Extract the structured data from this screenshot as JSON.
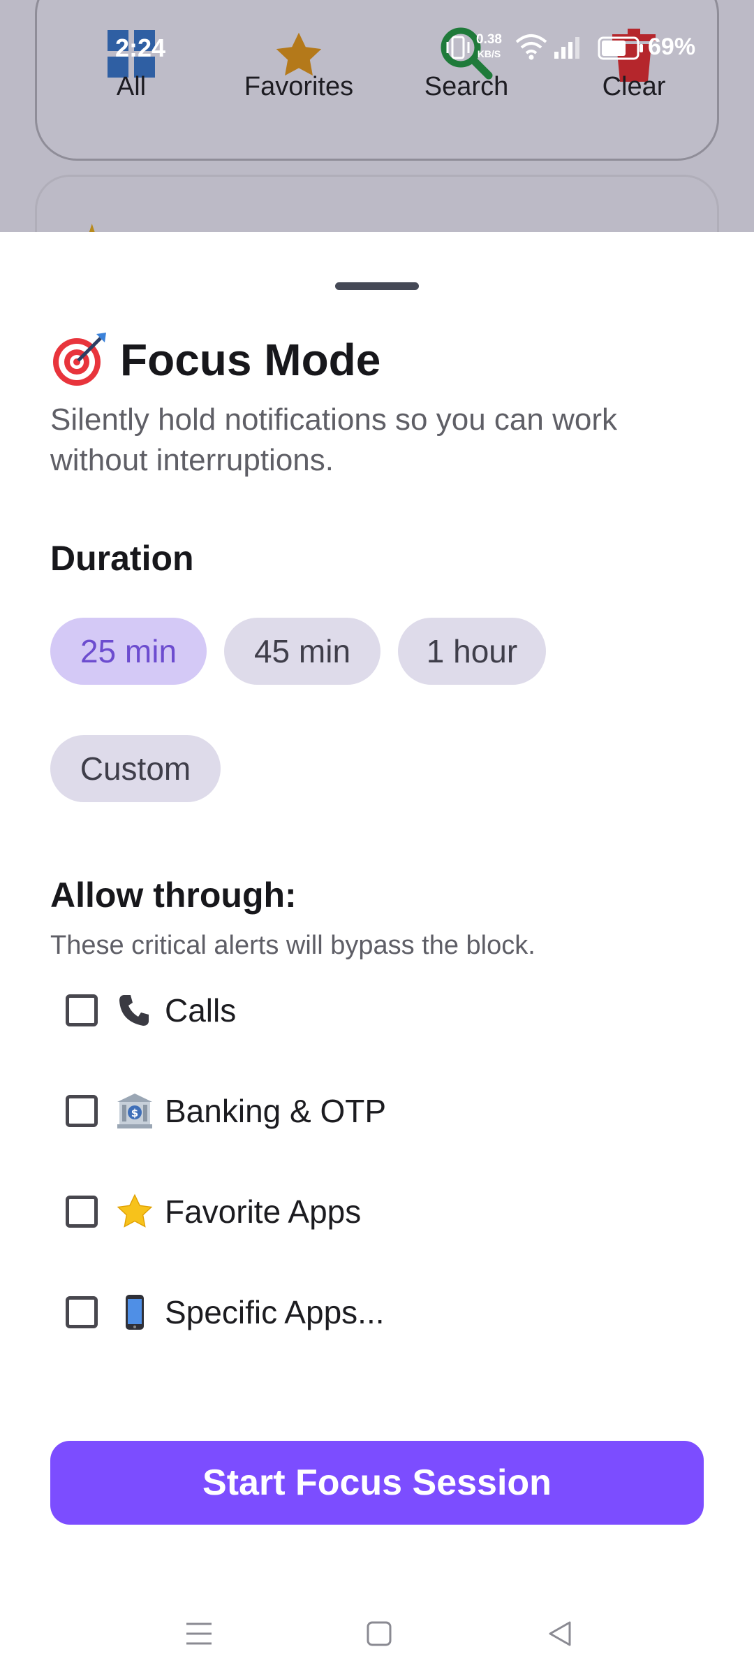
{
  "status_bar": {
    "time": "2:24",
    "net_speed_value": "0.38",
    "net_speed_unit": "KB/S",
    "battery": "69%"
  },
  "toolbar": {
    "items": [
      {
        "label": "All",
        "icon": "grid-icon",
        "color": "#2f5fa3"
      },
      {
        "label": "Favorites",
        "icon": "star-icon",
        "color": "#b4791a"
      },
      {
        "label": "Search",
        "icon": "search-icon",
        "color": "#1f7a3a"
      },
      {
        "label": "Clear",
        "icon": "trash-icon",
        "color": "#b5262c"
      }
    ]
  },
  "sheet": {
    "title": "Focus Mode",
    "title_icon": "target-icon",
    "subtitle": "Silently hold notifications so you can work without interruptions.",
    "duration_heading": "Duration",
    "durations": [
      {
        "label": "25 min",
        "selected": true
      },
      {
        "label": "45 min",
        "selected": false
      },
      {
        "label": "1 hour",
        "selected": false
      },
      {
        "label": "Custom",
        "selected": false
      }
    ],
    "allow_heading": "Allow through:",
    "allow_hint": "These critical alerts will bypass the block.",
    "allow_options": [
      {
        "label": "Calls",
        "icon": "phone-icon",
        "checked": false
      },
      {
        "label": "Banking & OTP",
        "icon": "bank-icon",
        "checked": false
      },
      {
        "label": "Favorite Apps",
        "icon": "star-icon",
        "checked": false
      },
      {
        "label": "Specific Apps...",
        "icon": "mobile-phone-icon",
        "checked": false
      }
    ],
    "start_button": "Start Focus Session"
  },
  "colors": {
    "accent": "#7c4dff",
    "chip_selected_bg": "#d4c9f6",
    "chip_selected_text": "#6c4ccf",
    "chip_bg": "#dedbea"
  },
  "nav": {
    "buttons": [
      "menu-icon",
      "home-square-icon",
      "back-triangle-icon"
    ]
  }
}
